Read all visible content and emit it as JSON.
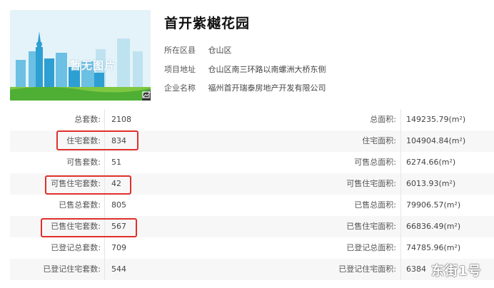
{
  "project": {
    "thumbnail_text": "暂无图片",
    "title": "首开紫樾花园",
    "info": [
      {
        "label": "所在区县",
        "value": "仓山区"
      },
      {
        "label": "项目地址",
        "value": "仓山区南三环路以南螺洲大桥东侧"
      },
      {
        "label": "企业名称",
        "value": "福州首开瑞泰房地产开发有限公司"
      }
    ]
  },
  "table": {
    "rows": [
      {
        "l1": "总套数:",
        "v1": "2108",
        "l2": "总面积:",
        "v2": "149235.79(m²)"
      },
      {
        "l1": "住宅套数:",
        "v1": "834",
        "l2": "住宅面积:",
        "v2": "104904.84(m²)"
      },
      {
        "l1": "可售套数:",
        "v1": "51",
        "l2": "可售总面积:",
        "v2": "6274.66(m²)"
      },
      {
        "l1": "可售住宅套数:",
        "v1": "42",
        "l2": "可售住宅面积:",
        "v2": "6013.93(m²)"
      },
      {
        "l1": "已售总套数:",
        "v1": "805",
        "l2": "已售总面积:",
        "v2": "79906.57(m²)"
      },
      {
        "l1": "已售住宅套数:",
        "v1": "567",
        "l2": "已售住宅面积:",
        "v2": "66836.49(m²)"
      },
      {
        "l1": "已登记总套数:",
        "v1": "709",
        "l2": "已登记总面积:",
        "v2": "74785.96(m²)"
      },
      {
        "l1": "已登记住宅套数:",
        "v1": "544",
        "l2": "已登记住宅面积:",
        "v2": "6384"
      }
    ]
  },
  "watermark": "东街1号",
  "colors": {
    "highlight": "#e0302b",
    "thumb_sky": "#dff0f7",
    "city": "#2e9fd2"
  },
  "icons": {
    "thumbnail_action": "image-edit-icon"
  }
}
